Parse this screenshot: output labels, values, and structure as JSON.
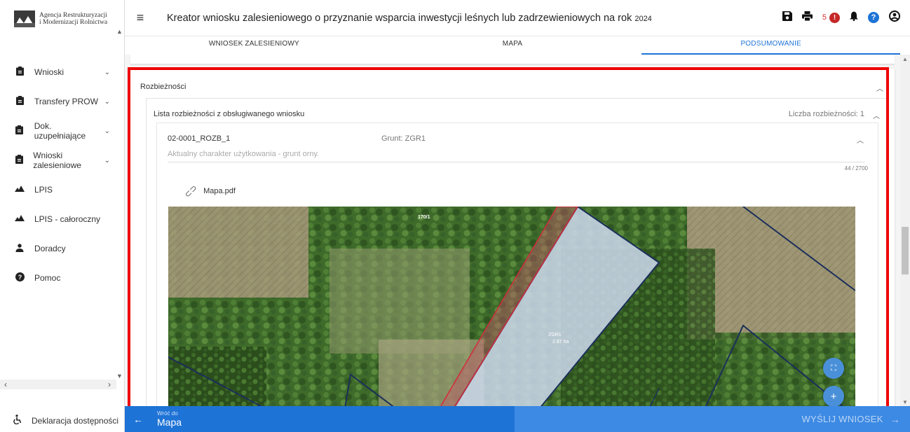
{
  "logo": {
    "line1": "Agencja Restrukturyzacji",
    "line2": "i Modernizacji Rolnictwa"
  },
  "sidebar": {
    "items": [
      {
        "label": "Wnioski",
        "icon": "clipboard-icon",
        "chevron": true
      },
      {
        "label": "Transfery PROW",
        "icon": "clipboard-icon",
        "chevron": true
      },
      {
        "label": "Dok. uzupełniające",
        "icon": "clipboard-icon",
        "chevron": true
      },
      {
        "label": "Wnioski zalesieniowe",
        "icon": "clipboard-icon",
        "chevron": true
      },
      {
        "label": "LPIS",
        "icon": "mountain-icon",
        "chevron": false
      },
      {
        "label": "LPIS - całoroczny",
        "icon": "mountain-icon",
        "chevron": false
      },
      {
        "label": "Doradcy",
        "icon": "person-icon",
        "chevron": false
      },
      {
        "label": "Pomoc",
        "icon": "help-icon",
        "chevron": false
      }
    ],
    "footer_label": "Deklaracja dostępności"
  },
  "header": {
    "title": "Kreator wniosku zalesieniowego o przyznanie wsparcia inwestycji leśnych lub zadrzewieniowych na rok",
    "year": "2024",
    "notification_count": "5",
    "error_badge": "!"
  },
  "tabs": [
    {
      "label": "WNIOSEK ZALESIENIOWY",
      "active": false
    },
    {
      "label": "MAPA",
      "active": false
    },
    {
      "label": "PODSUMOWANIE",
      "active": true
    }
  ],
  "section": {
    "title": "Rozbieżności",
    "list_title": "Lista rozbieżności z obsługiwanego wniosku",
    "count_label": "Liczba rozbieżności: 1",
    "item": {
      "id": "02-0001_ROZB_1",
      "grunt": "Grunt: ZGR1",
      "description": "Aktualny charakter użytkowania - grunt orny.",
      "counter": "44 / 2700",
      "attachment": "Mapa.pdf"
    }
  },
  "map": {
    "parcel_label": "170/1",
    "plot_label": "ZGR1",
    "plot_area": "2.87 ha"
  },
  "footer": {
    "back_small": "Wróć do",
    "back_main": "Mapa",
    "submit_label": "WYŚLIJ WNIOSEK"
  },
  "colors": {
    "accent": "#1e73d6",
    "highlight": "#ee0000",
    "error": "#c62828"
  }
}
